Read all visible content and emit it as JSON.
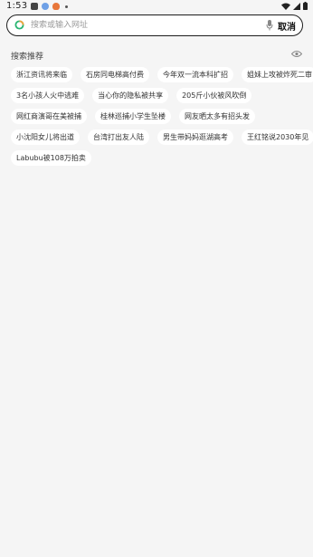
{
  "status_bar": {
    "time": "1:53",
    "left_icons": [
      "app-icon",
      "browser-icon",
      "news-icon"
    ],
    "right_icons": [
      "wifi-icon",
      "signal-icon",
      "battery-icon"
    ]
  },
  "search": {
    "placeholder": "搜索或输入网址",
    "cancel_label": "取消"
  },
  "recommendations": {
    "title": "搜索推荐",
    "rows": [
      [
        "浙江资讯将来临",
        "石房同电梯高付费",
        "今年双一流本科扩招",
        "姐妹上攻被炸死二审"
      ],
      [
        "3名小孩人火中逃难",
        "当心你的隐私被共享",
        "205斤小伙被风吹倒"
      ],
      [
        "网红商演哥在美被捕",
        "桂林巡捕小学生坠楼",
        "网友晒太多有招头发"
      ],
      [
        "小沈阳女儿将出道",
        "台湾打出友人陆",
        "男生带妈妈逛湖高考",
        "王红铭说2030年见"
      ],
      [
        "Labubu被108万拍卖"
      ]
    ]
  },
  "colors": {
    "background": "#f5f5f5",
    "chip": "#ffffff",
    "border": "#1c1c1c"
  }
}
